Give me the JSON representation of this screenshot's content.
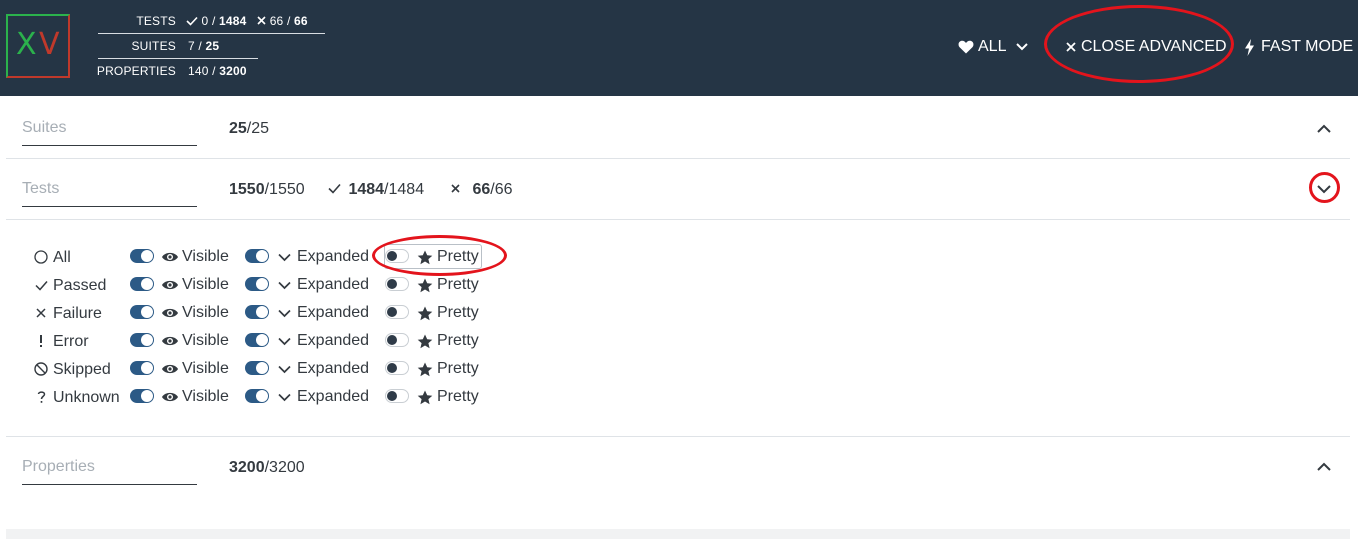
{
  "logo": {
    "x": "X",
    "v": "V"
  },
  "stats": {
    "tests_label": "TESTS",
    "tests_pass": "0",
    "tests_pass_total": "1484",
    "tests_fail": "66",
    "tests_fail_total": "66",
    "suites_label": "SUITES",
    "suites_val": "7",
    "suites_total": "25",
    "properties_label": "PROPERTIES",
    "properties_val": "140",
    "properties_total": "3200",
    "sep": " / "
  },
  "header": {
    "all_label": "ALL",
    "close_advanced_label": "CLOSE ADVANCED",
    "fast_mode_label": "FAST MODE"
  },
  "suites": {
    "label": "Suites",
    "count": "25",
    "total": "/25"
  },
  "tests": {
    "label": "Tests",
    "count": "1550",
    "total": "/1550",
    "pass_count": "1484",
    "pass_total": "/1484",
    "fail_count": "66",
    "fail_total": "/66"
  },
  "properties": {
    "label": "Properties",
    "count": "3200",
    "total": "/3200"
  },
  "filters": {
    "visible_label": "Visible",
    "expanded_label": "Expanded",
    "pretty_label": "Pretty",
    "rows": [
      {
        "label": "All",
        "icon": "circle-icon",
        "visible": true,
        "expanded": true,
        "pretty": false
      },
      {
        "label": "Passed",
        "icon": "check-icon",
        "visible": true,
        "expanded": true,
        "pretty": false
      },
      {
        "label": "Failure",
        "icon": "x-icon",
        "visible": true,
        "expanded": true,
        "pretty": false
      },
      {
        "label": "Error",
        "icon": "exclamation-icon",
        "visible": true,
        "expanded": true,
        "pretty": false
      },
      {
        "label": "Skipped",
        "icon": "ban-icon",
        "visible": true,
        "expanded": true,
        "pretty": false
      },
      {
        "label": "Unknown",
        "icon": "question-icon",
        "visible": true,
        "expanded": true,
        "pretty": false
      }
    ]
  },
  "colors": {
    "header_bg": "#253545",
    "toggle_on": "#2c5a86",
    "highlight_ring": "#e3141c",
    "logo_green": "#2bb24c",
    "logo_red": "#c0392b"
  }
}
